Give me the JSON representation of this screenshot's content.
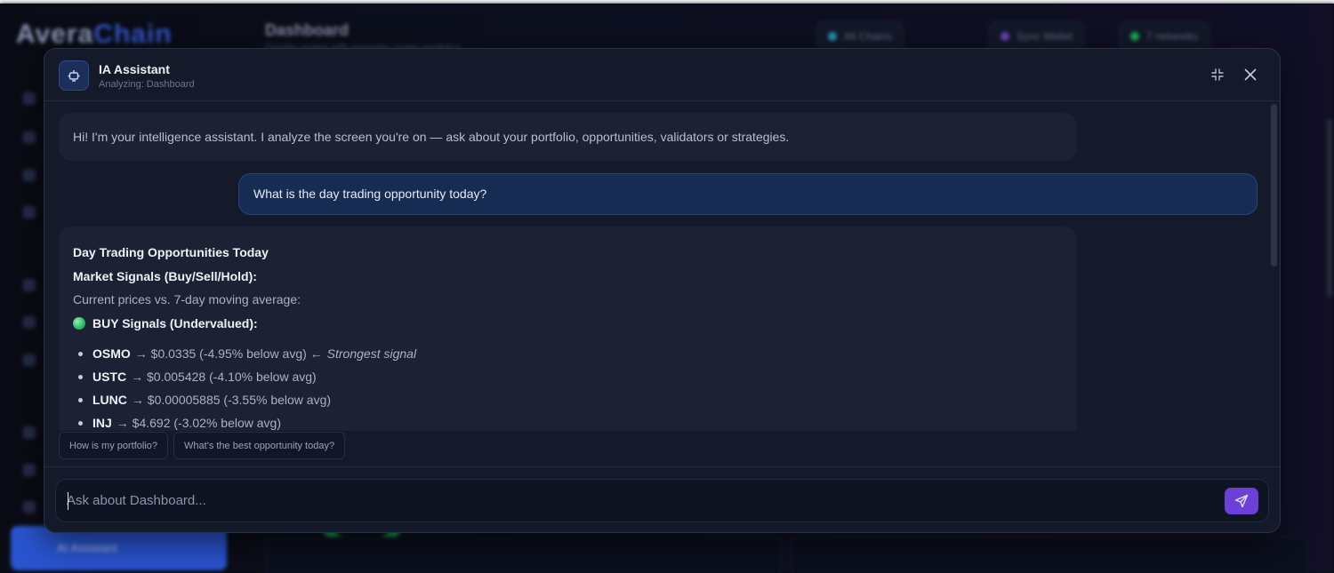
{
  "background": {
    "logo_part1": "Avera",
    "logo_part2": "Chain",
    "dashboard_title": "Dashboard",
    "dashboard_sub": "Quickly review with everyday crypto analytics",
    "pill_1": "All Chains",
    "pill_2": "Sync Wallet",
    "pill_3": "7 networks",
    "sidebar_button": "AI Assistant"
  },
  "assistant": {
    "title": "IA Assistant",
    "subtitle": "Analyzing: Dashboard",
    "minimize_icon": "collapse-icon",
    "close_icon": "close-icon"
  },
  "messages": {
    "greeting": "Hi! I'm your intelligence assistant. I analyze the screen you're on — ask about your portfolio, opportunities, validators or strategies.",
    "user_question": "What is the day trading opportunity today?",
    "response": {
      "title": "Day Trading Opportunities Today",
      "section_heading": "Market Signals (Buy/Sell/Hold):",
      "intro": "Current prices vs. 7-day moving average:",
      "buy_heading": "BUY Signals (Undervalued):",
      "buy_signals": [
        {
          "symbol": "OSMO",
          "detail": "→ $0.0335 (-4.95% below avg) ←",
          "note": "Strongest signal"
        },
        {
          "symbol": "USTC",
          "detail": "→ $0.005428 (-4.10% below avg)",
          "note": ""
        },
        {
          "symbol": "LUNC",
          "detail": "→ $0.00005885 (-3.55% below avg)",
          "note": ""
        },
        {
          "symbol": "INJ",
          "detail": "→ $4.692 (-3.02% below avg)",
          "note": ""
        }
      ]
    }
  },
  "suggestions": [
    "How is my portfolio?",
    "What's the best opportunity today?"
  ],
  "input": {
    "placeholder": "Ask about Dashboard...",
    "value": ""
  },
  "colors": {
    "accent": "#6b3fd8",
    "user_bubble": "#172c52",
    "assistant_bubble": "#1c2233",
    "buy_signal": "#2fbf6a"
  }
}
